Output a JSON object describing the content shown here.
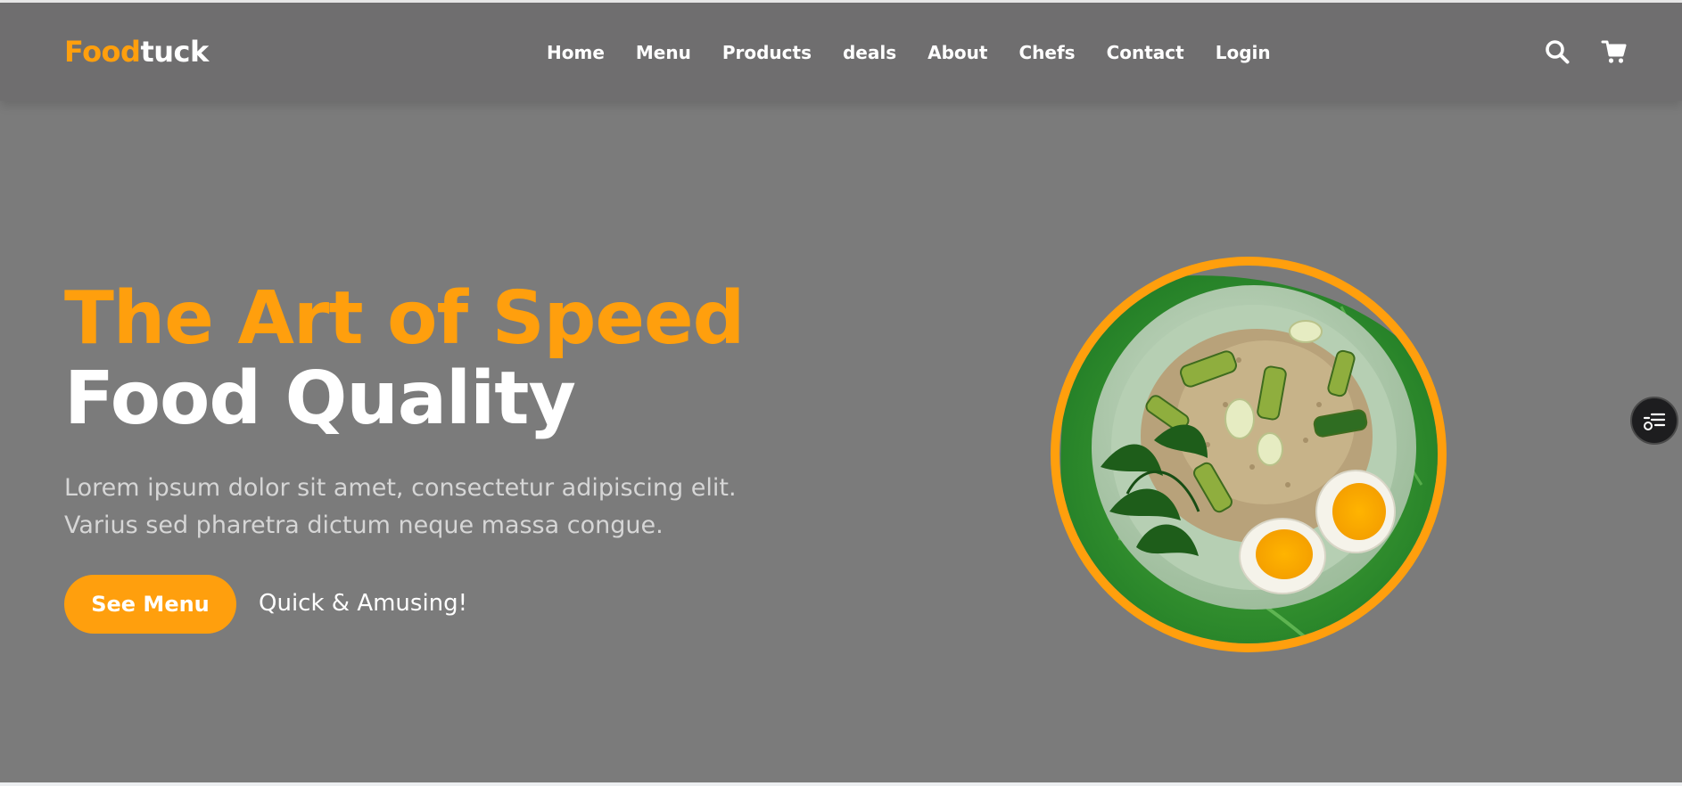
{
  "brand": {
    "part1": "Food",
    "part2": "tuck",
    "accent_color": "#ff9f0d"
  },
  "nav": {
    "items": [
      {
        "label": "Home"
      },
      {
        "label": "Menu"
      },
      {
        "label": "Products"
      },
      {
        "label": "deals"
      },
      {
        "label": "About"
      },
      {
        "label": "Chefs"
      },
      {
        "label": "Contact"
      },
      {
        "label": "Login"
      }
    ]
  },
  "header_icons": {
    "search": "search-icon",
    "cart": "cart-icon"
  },
  "hero": {
    "title_line1": "The Art of Speed",
    "title_line2": "Food Quality",
    "description": "Lorem ipsum dolor sit amet, consectetur adipiscing elit. Varius sed pharetra dictum neque massa congue.",
    "cta_label": "See Menu",
    "tagline": "Quick & Amusing!",
    "image": "food-bowl-image"
  },
  "side_widget": {
    "icon": "list-settings-icon"
  }
}
